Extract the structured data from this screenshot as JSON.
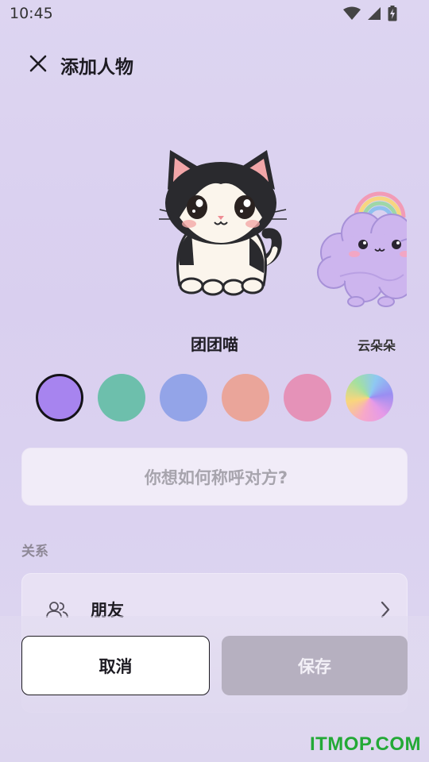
{
  "status_bar": {
    "time": "10:45",
    "icons": [
      "wifi-icon",
      "cell-signal-icon",
      "battery-charging-icon"
    ]
  },
  "header": {
    "title": "添加人物",
    "close_icon": "close-icon"
  },
  "characters": {
    "selected": {
      "name": "团团喵",
      "avatar": "cat-avatar"
    },
    "next": {
      "name": "云朵朵",
      "avatar": "cloud-avatar"
    }
  },
  "colors": {
    "options": [
      {
        "name": "purple",
        "hex": "#a784ef",
        "selected": true
      },
      {
        "name": "teal",
        "hex": "#6dbfac"
      },
      {
        "name": "blue",
        "hex": "#93a4e8"
      },
      {
        "name": "peach",
        "hex": "#eaa59a"
      },
      {
        "name": "pink",
        "hex": "#e592b8"
      },
      {
        "name": "rainbow",
        "gradient": "conic"
      }
    ]
  },
  "nickname": {
    "placeholder": "你想如何称呼对方?",
    "value": ""
  },
  "relationship": {
    "label": "关系",
    "value": "朋友",
    "icon": "people-icon"
  },
  "actions": {
    "cancel": "取消",
    "save": "保存"
  },
  "watermark": "ITMOP.COM"
}
